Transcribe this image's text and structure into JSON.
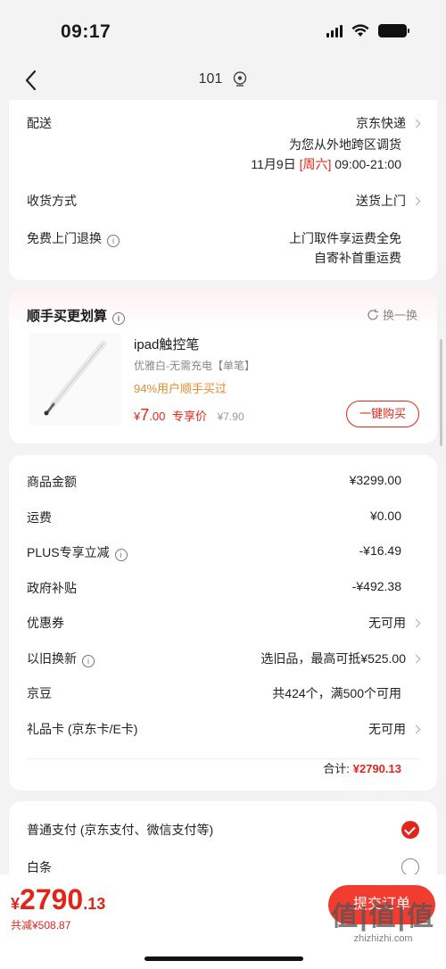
{
  "status": {
    "time": "09:17"
  },
  "nav": {
    "title": "101"
  },
  "delivery_card": {
    "shipping_label": "配送",
    "shipping_value": "京东快递",
    "shipping_line2": "为您从外地跨区调货",
    "shipping_date": "11月9日",
    "shipping_weekday": "[周六]",
    "shipping_time": "09:00-21:00",
    "receive_label": "收货方式",
    "receive_value": "送货上门",
    "return_label": "免费上门退换",
    "return_line1": "上门取件享运费全免",
    "return_line2": "自寄补首重运费"
  },
  "recommend": {
    "title": "顺手买更划算",
    "swap_label": "换一换",
    "product_name": "ipad触控笔",
    "product_spec": "优雅白-无需充电【单笔】",
    "product_bought": "94%用户顺手买过",
    "price_symbol": "¥",
    "price_int": "7",
    "price_dec": ".00",
    "price_tag": "专享价",
    "price_orig": "¥7.90",
    "buy_label": "一键购买"
  },
  "summary": {
    "rows": [
      {
        "label": "商品金额",
        "value": "¥3299.00"
      },
      {
        "label": "运费",
        "value": "¥0.00"
      },
      {
        "label": "PLUS专享立减",
        "value": "-¥16.49"
      },
      {
        "label": "政府补贴",
        "value": "-¥492.38"
      },
      {
        "label": "优惠券",
        "value": "无可用"
      },
      {
        "label": "以旧换新",
        "value": "选旧品，最高可抵¥525.00"
      },
      {
        "label": "京豆",
        "value": "共424个，满500个可用"
      },
      {
        "label": "礼品卡 (京东卡/E卡)",
        "value": "无可用"
      }
    ],
    "total_label": "合计:",
    "total_value": "¥2790.13"
  },
  "payment": {
    "normal_label": "普通支付 (京东支付、微信支付等)",
    "baitiao_label": "白条"
  },
  "bottom": {
    "yen": "¥",
    "total_int": "2790",
    "total_dec": ".13",
    "saved": "共减¥508.87",
    "submit": "提交订单"
  },
  "watermark": {
    "big": "值|值|值",
    "url": "zhizhizhi.com"
  },
  "colors": {
    "accent": "#e1251b",
    "orange": "#e88a2d",
    "background": "#f3f3f3"
  }
}
